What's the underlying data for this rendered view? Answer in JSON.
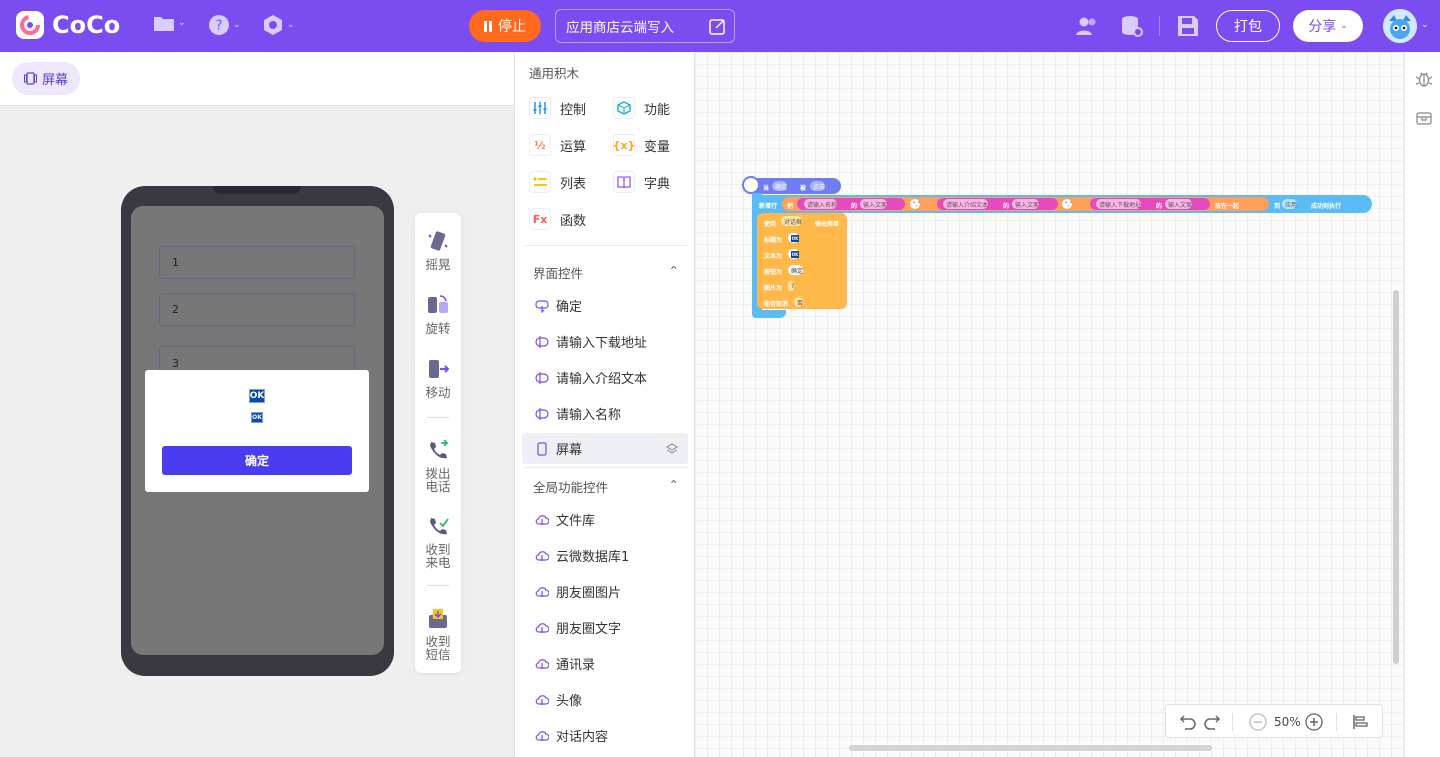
{
  "app": {
    "name": "CoCo"
  },
  "toolbar": {
    "stop_label": "停止",
    "cloud_write_label": "应用商店云端写入",
    "pack_label": "打包",
    "share_label": "分享"
  },
  "left": {
    "screen_tab": "屏幕"
  },
  "phone": {
    "inputs": [
      "1",
      "2",
      "3"
    ],
    "dialog": {
      "title_badge": "OK",
      "text_badge": "OK",
      "button": "确定"
    }
  },
  "sim": {
    "shake": "摇晃",
    "rotate": "旋转",
    "move": "移动",
    "dial": "拨出电话",
    "incoming": "收到来电",
    "sms": "收到短信"
  },
  "blocks_panel": {
    "general_title": "通用积木",
    "categories": [
      {
        "label": "控制",
        "icon": "control-icon",
        "color": "#1e9cf0"
      },
      {
        "label": "功能",
        "icon": "function-cube-icon",
        "color": "#1fb8c8"
      },
      {
        "label": "运算",
        "icon": "operator-icon",
        "color": "#ff7a45"
      },
      {
        "label": "变量",
        "icon": "variable-icon",
        "color": "#f5a623"
      },
      {
        "label": "列表",
        "icon": "list-icon",
        "color": "#f5c518"
      },
      {
        "label": "字典",
        "icon": "dictionary-icon",
        "color": "#9b59f0"
      },
      {
        "label": "函数",
        "icon": "fx-icon",
        "color": "#ff5a5a"
      }
    ],
    "ui_controls_title": "界面控件",
    "ui_controls": [
      "确定",
      "请输入下载地址",
      "请输入介绍文本",
      "请输入名称",
      "屏幕"
    ],
    "global_title": "全局功能控件",
    "global_controls": [
      "文件库",
      "云微数据库1",
      "朋友圈图片",
      "朋友圈文字",
      "通讯录",
      "头像",
      "对话内容"
    ]
  },
  "workspace": {
    "hat": {
      "when": "当",
      "target": "确定",
      "event_word": "被",
      "event": "点击"
    },
    "row": {
      "action": "新增行",
      "obj_word": "把",
      "in1": "请输入名称",
      "of1": "的",
      "prop1": "输入文案",
      "sep1": "\",\"",
      "in2": "请输入介绍文本",
      "of2": "的",
      "prop2": "输入文案",
      "sep2": "\",\"",
      "in3": "请输入下载地址",
      "of3": "的",
      "prop3": "输入文案",
      "join": "放在一起",
      "to": "到",
      "target": "应用",
      "after": "成功则执行"
    },
    "dialog_block": {
      "use": "使用",
      "type": "对话框",
      "popup": "弹出简单",
      "title_label": "标题为",
      "title_val": "OK",
      "text_label": "文本为",
      "text_val": "OK",
      "btn_label": "按钮为",
      "btn_val": "确定",
      "img_label": "图片为",
      "img_val": "?",
      "cancel_label": "能否取消",
      "cancel_val": "否"
    },
    "zoom": "50%"
  }
}
